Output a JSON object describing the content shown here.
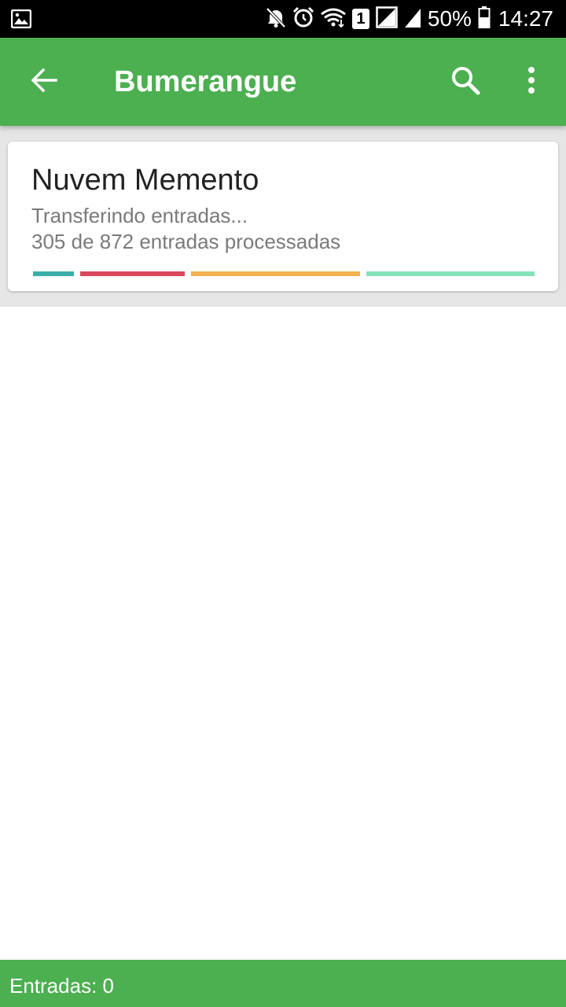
{
  "status_bar": {
    "battery": "50%",
    "time": "14:27",
    "sim_slot": "1",
    "icons": [
      "gallery-icon",
      "mute-icon",
      "alarm-icon",
      "wifi-icon",
      "sim-icon",
      "signal-icon",
      "signal-icon",
      "battery-icon"
    ]
  },
  "app_bar": {
    "title": "Bumerangue",
    "icons": [
      "back-arrow-icon",
      "search-icon",
      "more-vert-icon"
    ]
  },
  "card": {
    "title": "Nuvem Memento",
    "status": "Transferindo entradas...",
    "progress_text": "305 de 872 entradas processadas",
    "segment_colors": [
      "#3aafa9",
      "#d9485f",
      "#f0b04f",
      "#86e3b8"
    ]
  },
  "footer": {
    "entries": "Entradas: 0"
  },
  "colors": {
    "primary": "#4caf50",
    "status_bar": "#000000",
    "background": "#e6e6e6"
  }
}
